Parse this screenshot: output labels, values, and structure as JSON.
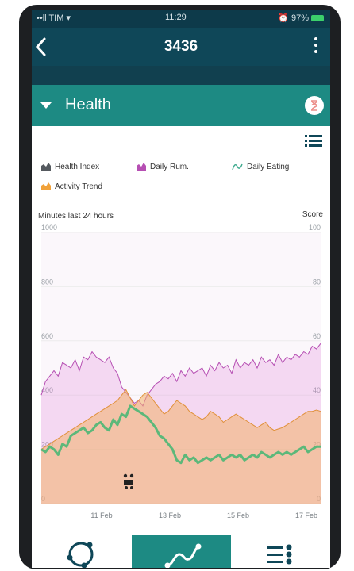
{
  "status_bar": {
    "left": "••ll TIM ▾",
    "time": "11:29",
    "right": "⏰ 97%"
  },
  "app_bar": {
    "title": "3436"
  },
  "section": {
    "title": "Health"
  },
  "legend": [
    {
      "label": "Health Index",
      "color": "#555a5f",
      "icon": "bar-icon"
    },
    {
      "label": "Daily Rum.",
      "color": "#b64fb3",
      "icon": "mountain-icon"
    },
    {
      "label": "Daily Eating",
      "color": "#3aa88c",
      "icon": "wave-icon"
    },
    {
      "label": "Activity Trend",
      "color": "#f1a23a",
      "icon": "mountain-icon"
    }
  ],
  "axis": {
    "left_title": "Minutes last 24 hours",
    "right_title": "Score"
  },
  "chart_data": {
    "type": "area",
    "x_tick_labels": [
      "11 Feb",
      "13 Feb",
      "15 Feb",
      "17 Feb"
    ],
    "ylim_left": [
      0,
      1000
    ],
    "ylim_right": [
      0,
      100
    ],
    "left_ticks": [
      "1000",
      "800",
      "600",
      "400",
      "200",
      "0"
    ],
    "right_ticks": [
      "100",
      "80",
      "60",
      "40",
      "20",
      "0"
    ],
    "grid": true,
    "series": [
      {
        "name": "Daily Rum.",
        "axis": "left",
        "color": "#e07ad7",
        "values": [
          400,
          450,
          470,
          490,
          470,
          520,
          510,
          500,
          530,
          490,
          540,
          530,
          560,
          540,
          530,
          520,
          540,
          500,
          480,
          430,
          410,
          390,
          370,
          380,
          360,
          400,
          420,
          440,
          450,
          470,
          460,
          480,
          450,
          490,
          470,
          500,
          480,
          490,
          500,
          470,
          510,
          490,
          520,
          500,
          510,
          480,
          530,
          500,
          520,
          510,
          530,
          500,
          540,
          520,
          530,
          510,
          550,
          520,
          540,
          530,
          550,
          540,
          560,
          550,
          580,
          570,
          590
        ]
      },
      {
        "name": "Activity Trend",
        "axis": "left",
        "color": "#f2b06a",
        "values": [
          200,
          210,
          220,
          230,
          240,
          250,
          260,
          270,
          280,
          290,
          300,
          310,
          320,
          330,
          340,
          350,
          360,
          370,
          380,
          400,
          420,
          390,
          360,
          380,
          400,
          410,
          390,
          370,
          350,
          330,
          340,
          360,
          380,
          370,
          360,
          340,
          330,
          320,
          310,
          320,
          340,
          330,
          320,
          300,
          310,
          320,
          330,
          320,
          310,
          300,
          290,
          280,
          290,
          300,
          280,
          270,
          275,
          280,
          290,
          300,
          310,
          320,
          330,
          340,
          340,
          345,
          340
        ]
      },
      {
        "name": "Daily Eating",
        "axis": "right",
        "color": "#5cb87a",
        "values": [
          20,
          19,
          21,
          20,
          18,
          22,
          21,
          25,
          26,
          27,
          28,
          26,
          27,
          29,
          30,
          28,
          27,
          31,
          29,
          33,
          32,
          36,
          35,
          34,
          33,
          32,
          30,
          28,
          25,
          24,
          22,
          20,
          16,
          15,
          18,
          16,
          17,
          15,
          16,
          17,
          16,
          17,
          18,
          16,
          17,
          18,
          17,
          18,
          16,
          17,
          18,
          17,
          19,
          18,
          17,
          18,
          19,
          18,
          19,
          18,
          19,
          20,
          21,
          19,
          20,
          21,
          21
        ]
      }
    ],
    "annotations": [
      "baby-stroller-icon"
    ]
  },
  "nav": [
    {
      "name": "nav-cycle",
      "icon": "cycle-icon"
    },
    {
      "name": "nav-trend",
      "icon": "trend-icon",
      "active": true
    },
    {
      "name": "nav-list",
      "icon": "list-icon"
    }
  ]
}
